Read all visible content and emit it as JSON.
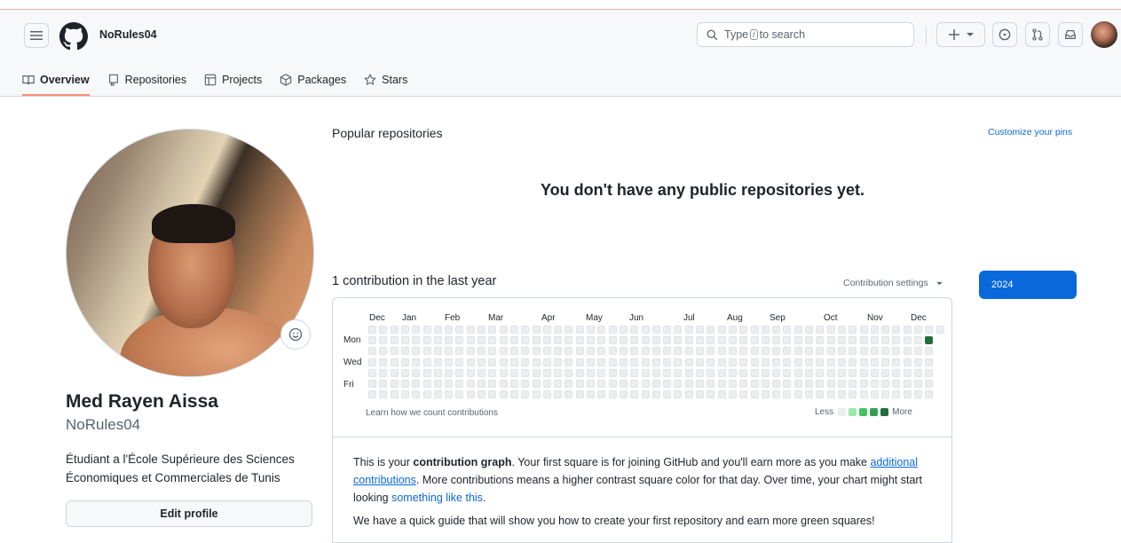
{
  "header": {
    "username": "NoRules04",
    "search_label": "Type",
    "search_key": "/",
    "search_suffix": "to search"
  },
  "tabs": [
    {
      "label": "Overview",
      "icon": "book-icon",
      "active": true
    },
    {
      "label": "Repositories",
      "icon": "repo-icon"
    },
    {
      "label": "Projects",
      "icon": "table-icon"
    },
    {
      "label": "Packages",
      "icon": "package-icon"
    },
    {
      "label": "Stars",
      "icon": "star-icon"
    }
  ],
  "profile": {
    "full_name": "Med Rayen Aissa",
    "login": "NoRules04",
    "bio": "Étudiant a l'École Supérieure des Sciences Économiques et Commerciales de Tunis",
    "edit_button": "Edit profile"
  },
  "popular": {
    "title": "Popular repositories",
    "customize": "Customize your pins",
    "empty_message": "You don't have any public repositories yet."
  },
  "contributions": {
    "count_text": "1 contribution in the last year",
    "settings_label": "Contribution settings",
    "year": "2024",
    "months": [
      "Dec",
      "Jan",
      "Feb",
      "Mar",
      "Apr",
      "May",
      "Jun",
      "Jul",
      "Aug",
      "Sep",
      "Oct",
      "Nov",
      "Dec"
    ],
    "days": [
      "Mon",
      "Wed",
      "Fri"
    ],
    "learn_link": "Learn how we count contributions",
    "less": "Less",
    "more": "More",
    "legend_colors": [
      "#ebedf0",
      "#9be9a8",
      "#40c463",
      "#30a14e",
      "#216e39"
    ],
    "active_cell": {
      "week": 51,
      "day": 1,
      "color": "#216e39"
    }
  },
  "info": {
    "p1_a": "This is your ",
    "p1_b": "contribution graph",
    "p1_c": ". Your first square is for joining GitHub and you'll earn more as you make ",
    "p1_link1": "additional contributions",
    "p1_d": ". More contributions means a higher contrast square color for that day. Over time, your chart might start looking ",
    "p1_link2": "something like this",
    "p1_e": ".",
    "p2": "We have a quick guide that will show you how to create your first repository and earn more green squares!"
  }
}
